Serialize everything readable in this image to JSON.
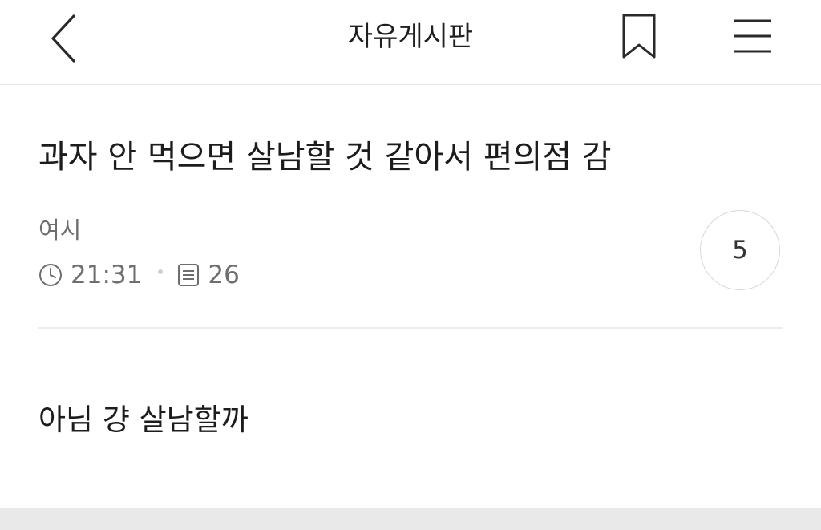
{
  "header": {
    "title": "자유게시판",
    "back_icon": "chevron-left-icon",
    "bookmark_icon": "bookmark-icon",
    "menu_icon": "hamburger-menu-icon"
  },
  "post": {
    "title": "과자 안 먹으면 살남할 것 같아서 편의점 감",
    "author": "여시",
    "time": "21:31",
    "views": "26",
    "comment_count": "5",
    "body": "아님 걍 살남할까"
  },
  "colors": {
    "text_primary": "#1c1c1c",
    "text_secondary": "#6e6e6e",
    "divider": "#ececec",
    "bottom_band": "#e9e9e9"
  }
}
